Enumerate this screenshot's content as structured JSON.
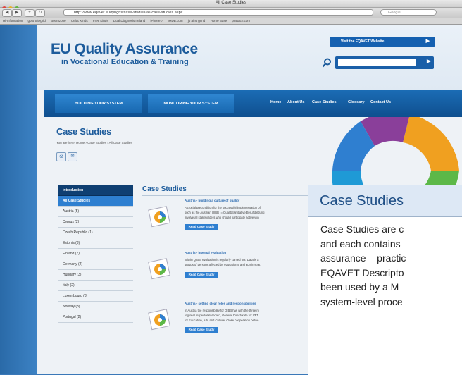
{
  "browser": {
    "window_title": "All Case Studies",
    "url": "http://www.eqavet.eu/qa/gns/case-studies/all-case-studies.aspx",
    "search_placeholder": "Google",
    "nav_back": "◀",
    "nav_forward": "▶",
    "bookmarks": [
      "Hi-Information",
      "goto Sitegrid",
      "Boomzone",
      "Celtic Kinds",
      "Free Kinds",
      "Dual Diagnosis Ireland",
      "iPhone 7",
      "IMDB.com",
      "jo ainu grind",
      "Home Base",
      "prasach.com"
    ]
  },
  "site": {
    "title_line1": "EU Quality Assurance",
    "title_line2": "in Vocational Education & Training",
    "visit_button": "Visit the EQAVET Website",
    "search_placeholder": "",
    "tabs": [
      "BUILDING YOUR SYSTEM",
      "MONITORING YOUR SYSTEM"
    ],
    "top_links": [
      "Home",
      "About Us",
      "Case Studies",
      "Glossary",
      "Contact Us"
    ],
    "page_title": "Case Studies",
    "breadcrumb": "You are here: Home › Case Studies › All Case Studies"
  },
  "sidebar": {
    "items": [
      {
        "label": "Introduction",
        "style": "dark"
      },
      {
        "label": "All Case Studies",
        "style": "active"
      },
      {
        "label": "Austria (5)",
        "style": ""
      },
      {
        "label": "Cyprus (2)",
        "style": ""
      },
      {
        "label": "Czech Republic (1)",
        "style": ""
      },
      {
        "label": "Estonia (3)",
        "style": ""
      },
      {
        "label": "Finland (7)",
        "style": ""
      },
      {
        "label": "Germany (2)",
        "style": ""
      },
      {
        "label": "Hungary (3)",
        "style": ""
      },
      {
        "label": "Italy (2)",
        "style": ""
      },
      {
        "label": "Luxembourg (3)",
        "style": ""
      },
      {
        "label": "Norway (3)",
        "style": ""
      },
      {
        "label": "Portugal (2)",
        "style": ""
      }
    ]
  },
  "content": {
    "heading": "Case Studies",
    "cases": [
      {
        "title": "Austria - building a culture of quality",
        "lines": [
          "A crucial precondition for the successful implementation of",
          "such as the Austrian QIBB (= Qualitätsinitiative Berufsbildung",
          "involve all stakeholders who should participate actively in"
        ],
        "button": "Read Case Study"
      },
      {
        "title": "Austria - internal evaluation",
        "lines": [
          "Within QIBB, evaluation is regularly carried out. Data is a",
          "groups of persons affected by educational and administrat"
        ],
        "button": "Read Case Study"
      },
      {
        "title": "Austria - setting clear roles and responsibilities",
        "lines": [
          "In Austria the responsibility for QIBB has with the three m",
          "regional inspectorate/board, General Directorate for VET",
          "for Education, Arts and Culture. Close cooperation betwe"
        ],
        "button": "Read Case Study"
      }
    ]
  },
  "callout": {
    "title": "Case Studies",
    "lines": [
      "Case Studies are c",
      "and each contains",
      "assurance    practic",
      "EQAVET Descripto",
      "been used by a M",
      "system-level proce"
    ]
  },
  "colors": {
    "brand_blue": "#1d5c9c",
    "menu_blue": "#1b6cb5",
    "active_blue": "#2e7fd0",
    "dark_navy": "#0f3f72"
  }
}
